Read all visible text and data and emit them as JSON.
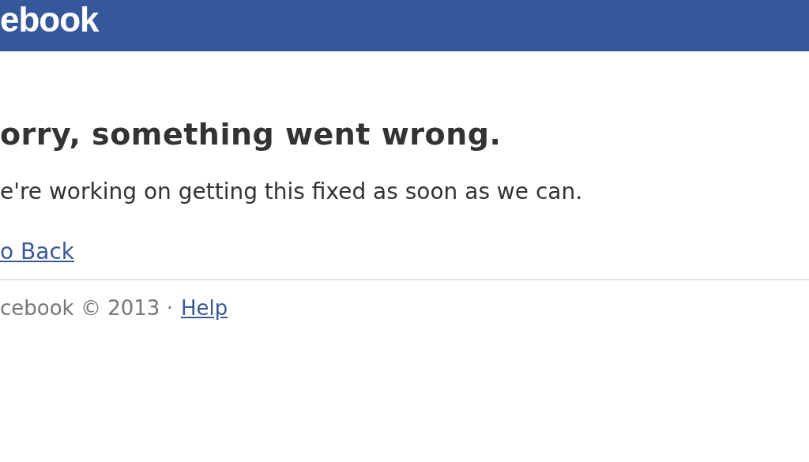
{
  "header": {
    "logo": "ebook"
  },
  "error": {
    "title": "orry, something went wrong.",
    "message": "e're working on getting this fixed as soon as we can.",
    "link": "o Back"
  },
  "footer": {
    "copyright": "cebook © 2013 ·",
    "link": "Help"
  }
}
